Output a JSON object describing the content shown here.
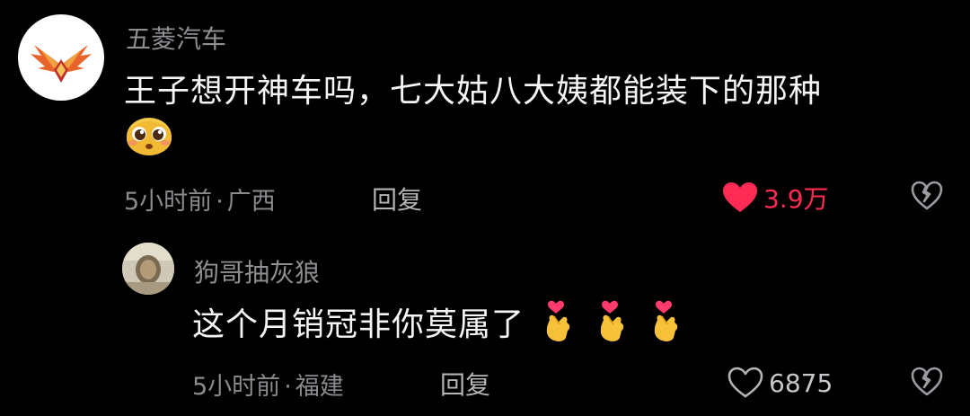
{
  "comments": [
    {
      "username": "五菱汽车",
      "text": "王子想开神车吗，七大姑八大姨都能装下的那种",
      "emoji": "pleading-face",
      "time": "5小时前",
      "separator": "·",
      "location": "广西",
      "reply_label": "回复",
      "likes": "3.9万",
      "liked": true,
      "like_color": "#fe2c55",
      "avatar_icon": "wuling-logo-icon",
      "replies": [
        {
          "username": "狗哥抽灰狼",
          "text": "这个月销冠非你莫属了",
          "emojis": [
            "finger-heart",
            "finger-heart",
            "finger-heart"
          ],
          "time": "5小时前",
          "separator": "·",
          "location": "福建",
          "reply_label": "回复",
          "likes": "6875",
          "liked": false
        }
      ]
    }
  ]
}
